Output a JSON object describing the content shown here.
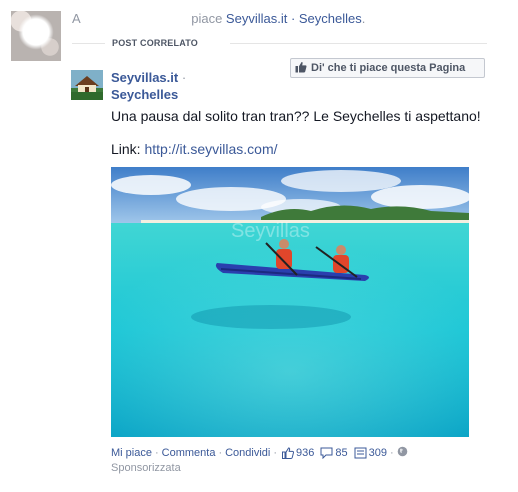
{
  "story": {
    "actor_initial": "A",
    "verb": "piace",
    "page_link": "Seyvillas.it · Seychelles",
    "suffix": "."
  },
  "related": {
    "label": "POST CORRELATO"
  },
  "page": {
    "name_line1": "Seyvillas.it",
    "separator": "·",
    "name_line2": "Seychelles",
    "like_button_label": "Di' che ti piace questa Pagina"
  },
  "post": {
    "text": "Una pausa dal solito tran tran?? Le Seychelles ti aspettano!",
    "link_label": "Link:",
    "link_url": "http://it.seyvillas.com/"
  },
  "photo": {
    "watermark": "Seyvillas"
  },
  "footer": {
    "like": "Mi piace",
    "comment": "Commenta",
    "share": "Condividi",
    "likes_count": "936",
    "comments_count": "85",
    "shares_count": "309",
    "sponsored": "Sponsorizzata"
  },
  "icons": {
    "thumb": "thumbs-up-icon",
    "comment": "comment-bubble-icon",
    "share": "share-icon",
    "globe": "globe-icon"
  }
}
